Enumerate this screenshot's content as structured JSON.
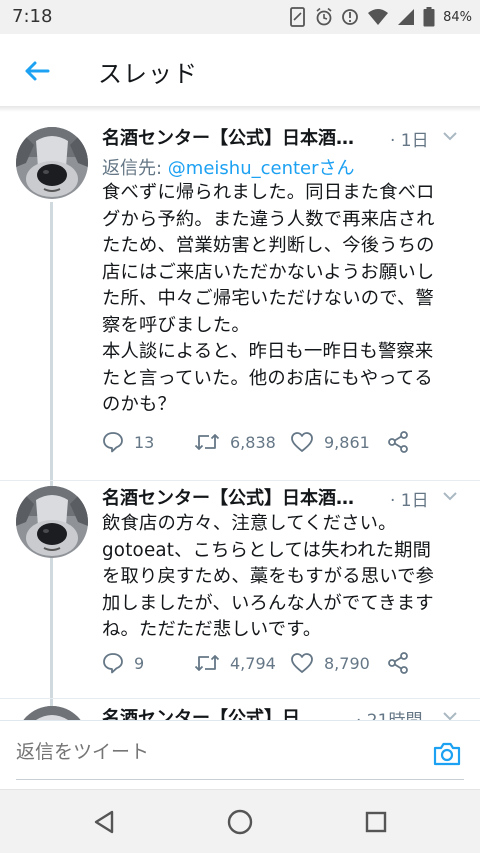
{
  "status_bar": {
    "time": "7:18",
    "battery": "84%"
  },
  "header": {
    "title": "スレッド"
  },
  "tweets": [
    {
      "name": "名酒センター【公式】日本酒…",
      "time": "· 1日",
      "reply_prefix": "返信先: ",
      "reply_handle": "@meishu_center",
      "reply_suffix": "さん",
      "text": "食べずに帰られました。同日また食べロ\nグから予約。また違う人数で再来店され\nたため、営業妨害と判断し、今後うちの\n店にはご来店いただかないようお願いし\nた所、中々ご帰宅いただけないので、警\n察を呼びました。\n本人談によると、昨日も一昨日も警察来\nたと言っていた。他のお店にもやってる\nのかも？",
      "replies": "13",
      "retweets": "6,838",
      "likes": "9,861"
    },
    {
      "name": "名酒センター【公式】日本酒…",
      "time": "· 1日",
      "text": "飲食店の方々、注意してください。\ngotoeat、こちらとしては失われた期間\nを取り戻すため、藁をもすがる思いで参\n加しましたが、いろんな人がでてきます\nね。ただただ悲しいです。",
      "replies": "9",
      "retweets": "4,794",
      "likes": "8,790"
    },
    {
      "name": "名酒センター【公式】日",
      "time": "· 21時間"
    }
  ],
  "reply_bar": {
    "placeholder": "返信をツイート"
  },
  "colors": {
    "accent": "#1da1f2",
    "secondary_text": "#657786",
    "thread_line": "#cfd9de"
  },
  "icons": {
    "back": "arrow-left-icon",
    "caret": "chevron-down-icon",
    "reply": "speech-bubble-icon",
    "retweet": "retweet-icon",
    "like": "heart-icon",
    "share": "share-icon",
    "camera": "camera-icon"
  }
}
